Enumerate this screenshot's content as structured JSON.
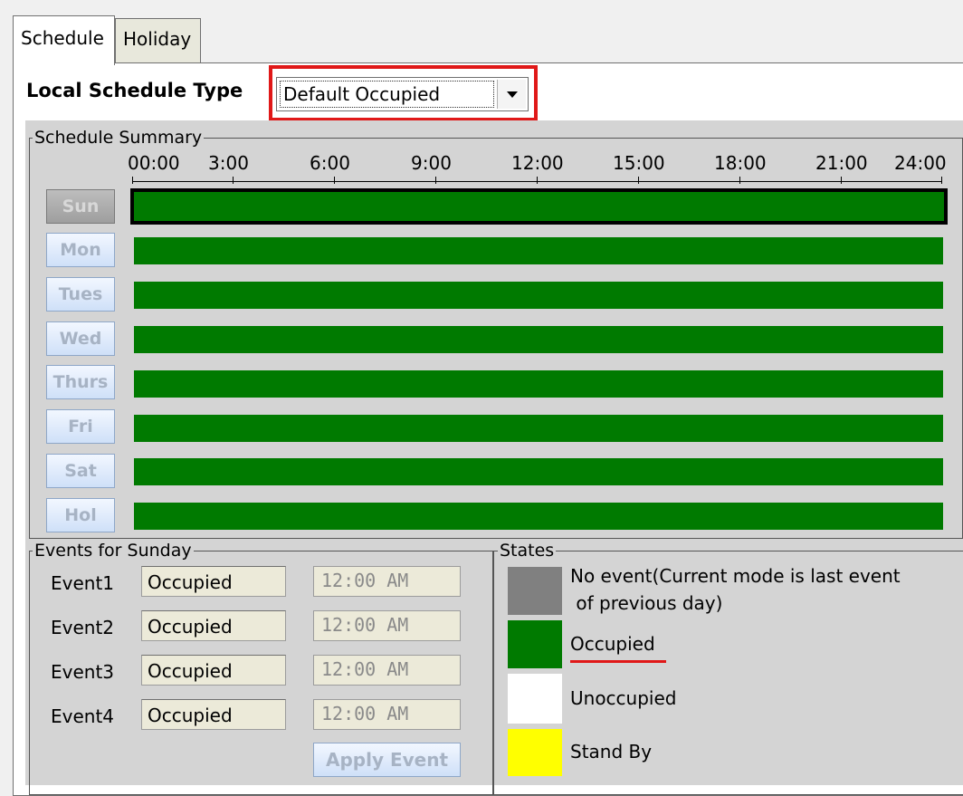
{
  "tabs": [
    {
      "label": "Schedule"
    },
    {
      "label": "Holiday"
    }
  ],
  "schedule_type": {
    "label": "Local Schedule Type",
    "value": "Default Occupied"
  },
  "summary": {
    "title": "Schedule Summary",
    "times": [
      "00:00",
      "3:00",
      "6:00",
      "9:00",
      "12:00",
      "15:00",
      "18:00",
      "21:00",
      "24:00"
    ],
    "days": [
      {
        "label": "Sun",
        "state": "Occupied",
        "selected": true
      },
      {
        "label": "Mon",
        "state": "Occupied",
        "selected": false
      },
      {
        "label": "Tues",
        "state": "Occupied",
        "selected": false
      },
      {
        "label": "Wed",
        "state": "Occupied",
        "selected": false
      },
      {
        "label": "Thurs",
        "state": "Occupied",
        "selected": false
      },
      {
        "label": "Fri",
        "state": "Occupied",
        "selected": false
      },
      {
        "label": "Sat",
        "state": "Occupied",
        "selected": false
      },
      {
        "label": "Hol",
        "state": "Occupied",
        "selected": false
      }
    ]
  },
  "events": {
    "title": "Events for Sunday",
    "items": [
      {
        "label": "Event1",
        "state": "Occupied",
        "time": "12:00 AM"
      },
      {
        "label": "Event2",
        "state": "Occupied",
        "time": "12:00 AM"
      },
      {
        "label": "Event3",
        "state": "Occupied",
        "time": "12:00 AM"
      },
      {
        "label": "Event4",
        "state": "Occupied",
        "time": "12:00 AM"
      }
    ],
    "apply_label": "Apply Event"
  },
  "states": {
    "title": "States",
    "items": [
      {
        "label_line1": "No event(Current mode is last event",
        "label_line2": " of previous day)",
        "color": "#808080"
      },
      {
        "label_line1": "Occupied",
        "label_line2": "",
        "color": "#007a00"
      },
      {
        "label_line1": "Unoccupied",
        "label_line2": "",
        "color": "#ffffff"
      },
      {
        "label_line1": "Stand By",
        "label_line2": "",
        "color": "#ffff00"
      }
    ]
  },
  "colors": {
    "occupied": "#007a00",
    "highlight": "#e01818"
  }
}
